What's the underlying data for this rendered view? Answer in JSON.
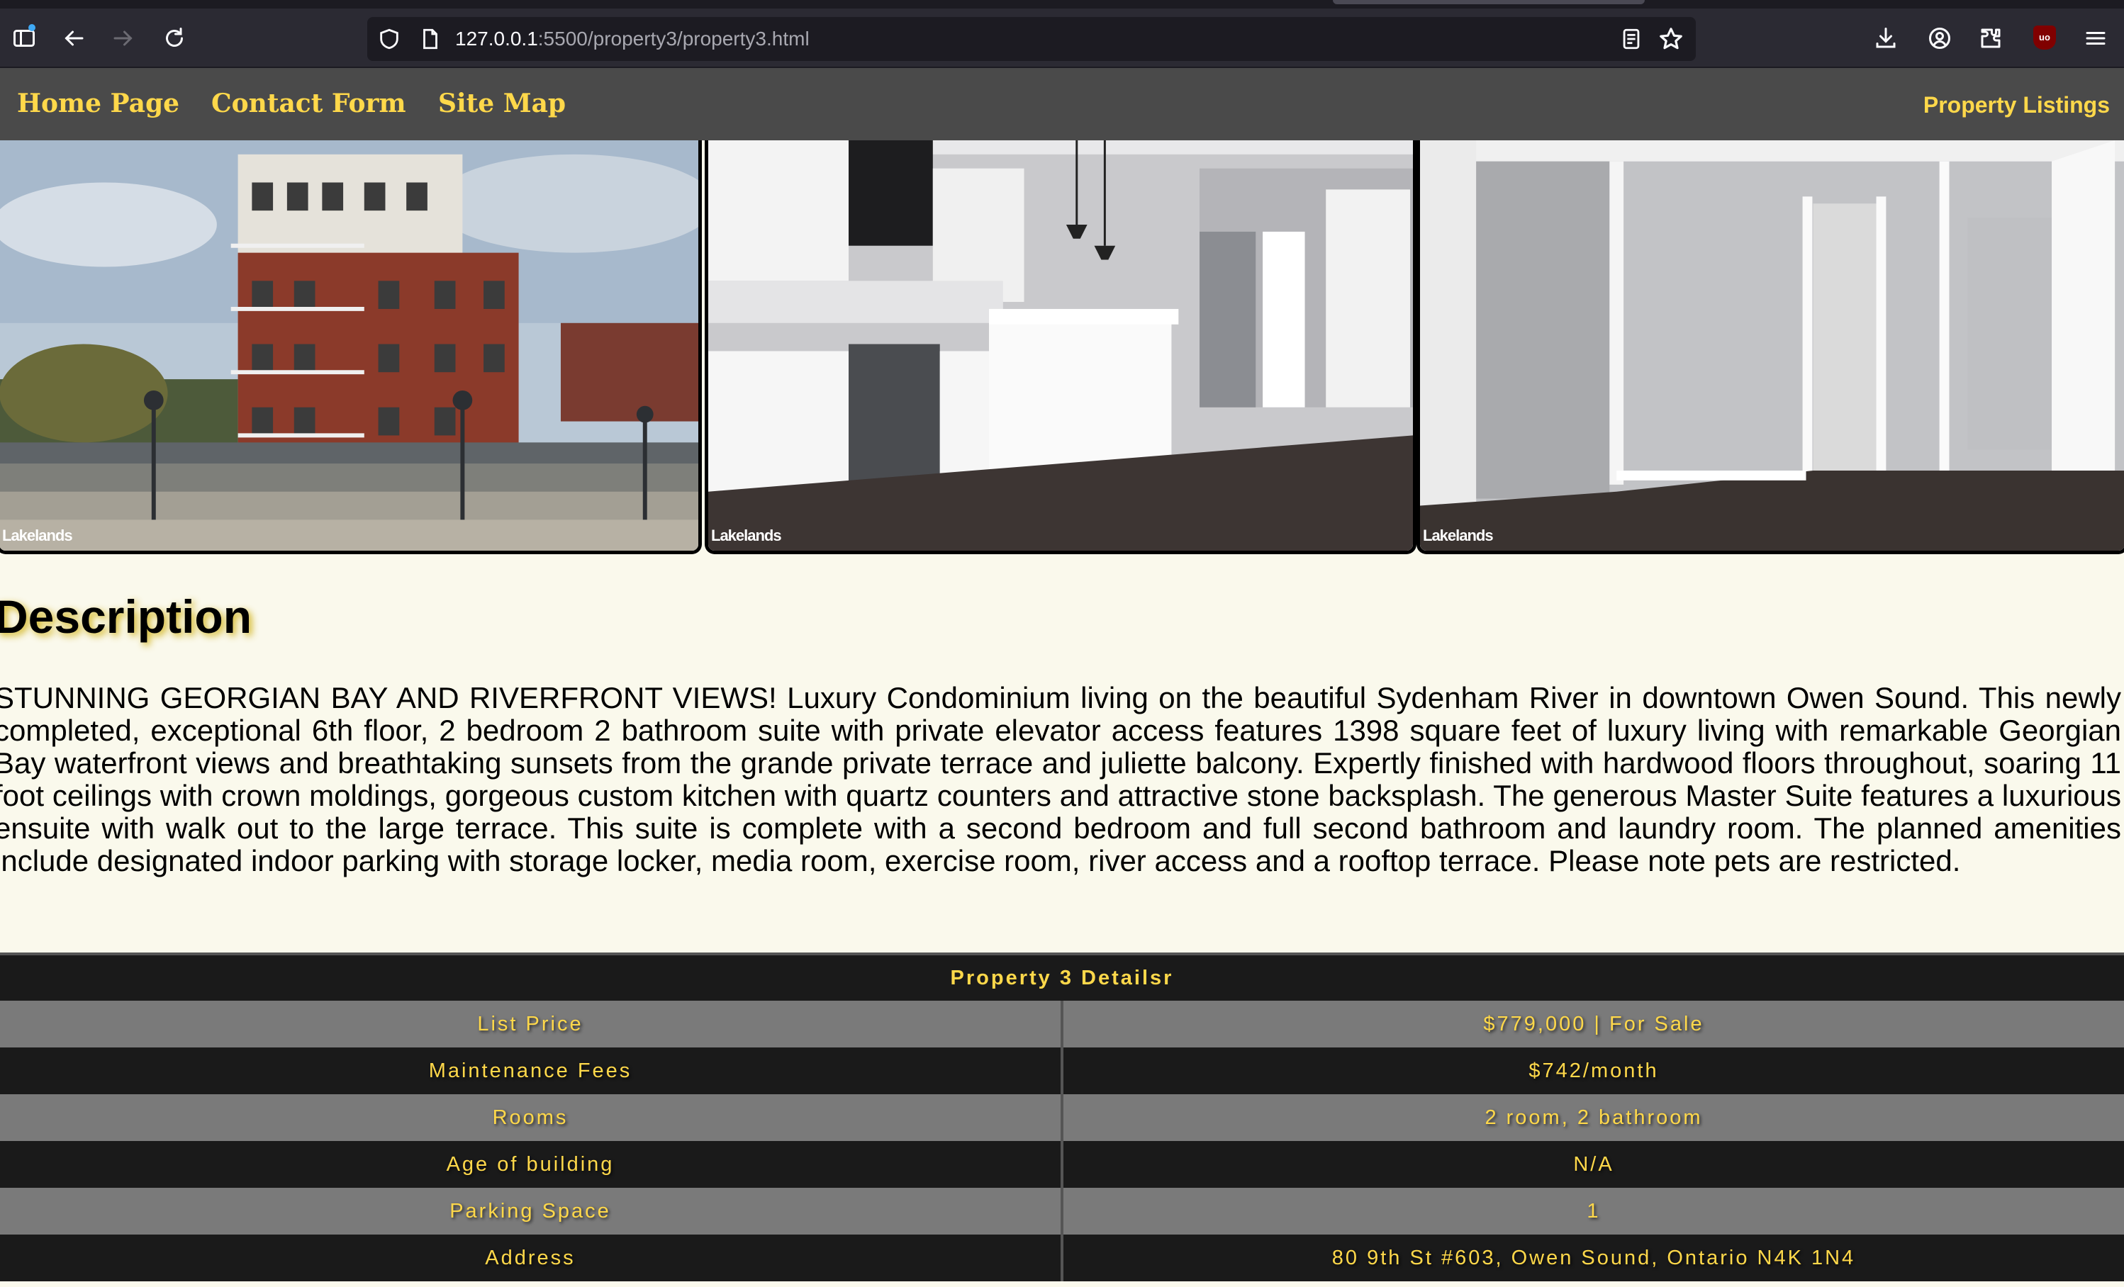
{
  "browser": {
    "url_host": "127.0.0.1",
    "url_rest": ":5500/property3/property3.html",
    "extension_badge": "uo"
  },
  "nav": {
    "home": "Home Page",
    "contact": "Contact Form",
    "sitemap": "Site Map",
    "listings": "Property Listings"
  },
  "photos": [
    {
      "alt": "building-exterior",
      "watermark": "Lakelands"
    },
    {
      "alt": "kitchen",
      "watermark": "Lakelands"
    },
    {
      "alt": "bedroom",
      "watermark": "Lakelands"
    }
  ],
  "description": {
    "heading": "Description",
    "body": "STUNNING GEORGIAN BAY AND RIVERFRONT VIEWS! Luxury Condominium living on the beautiful Sydenham River in downtown Owen Sound. This newly completed, exceptional 6th floor, 2 bedroom 2 bathroom suite with private elevator access features 1398 square feet of luxury living with remarkable Georgian Bay waterfront views and breathtaking sunsets from the grande private terrace and juliette balcony. Expertly finished with hardwood floors throughout, soaring 11 foot ceilings with crown moldings, gorgeous custom kitchen with quartz counters and attractive stone backsplash. The generous Master Suite features a luxurious ensuite with walk out to the large terrace. This suite is complete with a second bedroom and full second bathroom and laundry room. The planned amenities include designated indoor parking with storage locker, media room, exercise room, river access and a rooftop terrace. Please note pets are restricted."
  },
  "details": {
    "title": "Property 3 Detailsr",
    "rows": [
      {
        "label": "List Price",
        "value": "$779,000 | For Sale"
      },
      {
        "label": "Maintenance Fees",
        "value": "$742/month"
      },
      {
        "label": "Rooms",
        "value": "2 room, 2 bathroom"
      },
      {
        "label": "Age of building",
        "value": "N/A"
      },
      {
        "label": "Parking Space",
        "value": "1"
      },
      {
        "label": "Address",
        "value": "80 9th St #603, Owen Sound, Ontario N4K 1N4"
      }
    ]
  },
  "colors": {
    "accent": "#ffd84a",
    "nav_bg": "#4a4a4a",
    "page_bg": "#faf9ec"
  }
}
